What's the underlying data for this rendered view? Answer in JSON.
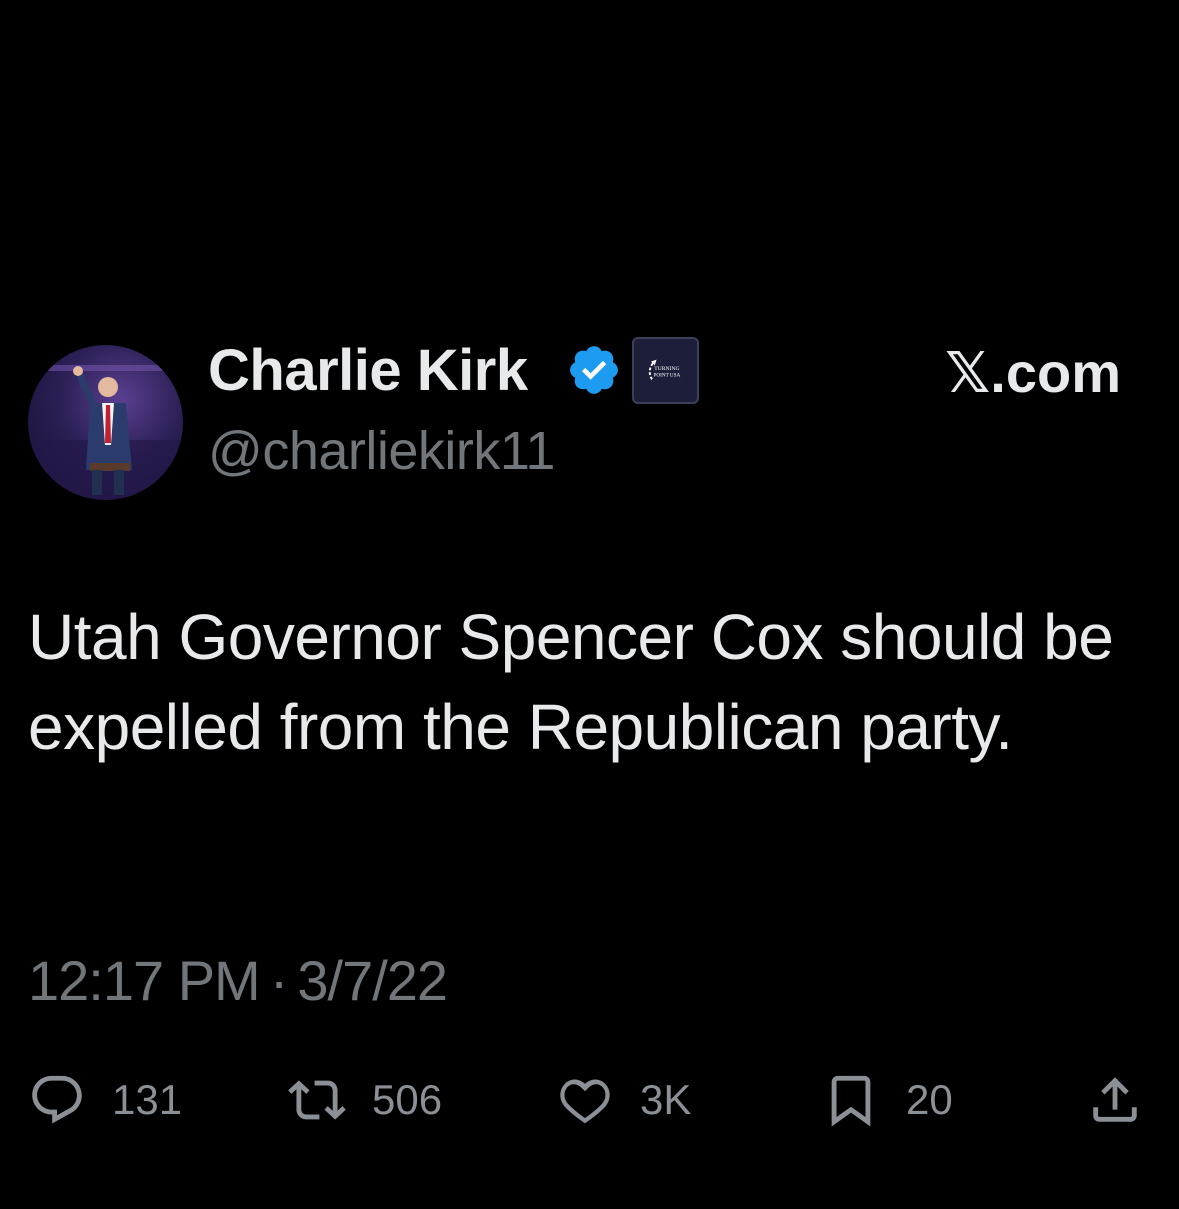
{
  "header": {
    "display_name": "Charlie Kirk",
    "handle": "@charliekirk11",
    "site_label": "𝕏.com",
    "verified_icon": "verified-badge-icon",
    "org_badge_icon": "turning-point-usa-logo",
    "org_badge_text": "TURNING POINT USA",
    "verified_color": "#1d9bf0"
  },
  "tweet": {
    "text": "Utah Governor Spencer Cox should be expelled from the Republican party.",
    "time": "12:17 PM",
    "separator": "·",
    "date": "3/7/22"
  },
  "actions": {
    "replies": "131",
    "retweets": "506",
    "likes": "3K",
    "bookmarks": "20",
    "reply_icon": "reply-icon",
    "retweet_icon": "retweet-icon",
    "like_icon": "heart-icon",
    "bookmark_icon": "bookmark-icon",
    "share_icon": "share-icon"
  }
}
